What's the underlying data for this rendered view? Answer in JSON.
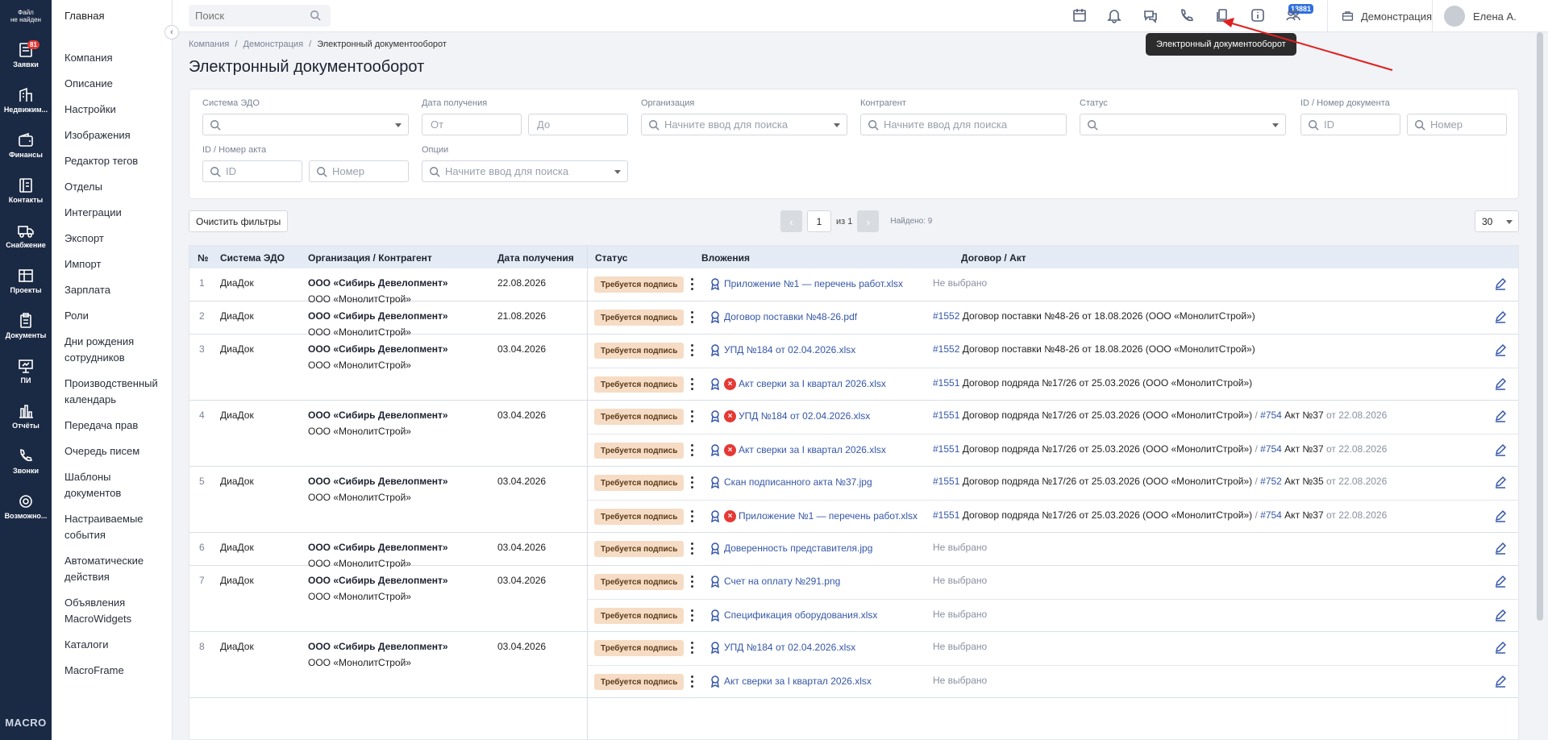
{
  "rail": {
    "logo_line1": "Файл",
    "logo_line2": "не найден",
    "items": [
      {
        "label": "Заявки",
        "icon": "requests-icon",
        "badge": "81"
      },
      {
        "label": "Недвижим...",
        "icon": "building-icon"
      },
      {
        "label": "Финансы",
        "icon": "wallet-icon"
      },
      {
        "label": "Контакты",
        "icon": "contacts-icon"
      },
      {
        "label": "Снабжение",
        "icon": "truck-icon"
      },
      {
        "label": "Проекты",
        "icon": "projects-icon"
      },
      {
        "label": "Документы",
        "icon": "documents-icon"
      },
      {
        "label": "ПИ",
        "icon": "presentation-icon"
      },
      {
        "label": "Отчёты",
        "icon": "reports-icon"
      },
      {
        "label": "Звонки",
        "icon": "phone-icon"
      },
      {
        "label": "Возможно...",
        "icon": "gear-icon"
      }
    ],
    "brand": "MACRO"
  },
  "sidebar": {
    "home": "Главная",
    "items": [
      "Компания",
      "Описание",
      "Настройки",
      "Изображения",
      "Редактор тегов",
      "Отделы",
      "Интеграции",
      "Экспорт",
      "Импорт",
      "Зарплата",
      "Роли",
      "Дни рождения сотрудников",
      "Производственный календарь",
      "Передача прав",
      "Очередь писем",
      "Шаблоны документов",
      "Настраиваемые события",
      "Автоматические действия",
      "Объявления MacroWidgets",
      "Каталоги",
      "MacroFrame"
    ]
  },
  "topbar": {
    "search_placeholder": "Поиск",
    "notif_count": "13881",
    "workspace": "Демонстрация",
    "user": "Елена А.",
    "tooltip": "Электронный документооборот"
  },
  "breadcrumb": {
    "items": [
      "Компания",
      "Демонстрация"
    ],
    "current": "Электронный документооборот",
    "sep": "/"
  },
  "page_title": "Электронный документооборот",
  "filters": {
    "edo_label": "Система ЭДО",
    "date_label": "Дата получения",
    "date_from": "От",
    "date_to": "До",
    "org_label": "Организация",
    "org_ph": "Начните ввод для поиска",
    "contr_label": "Контрагент",
    "contr_ph": "Начните ввод для поиска",
    "status_label": "Статус",
    "docid_label": "ID / Номер документа",
    "id_ph": "ID",
    "num_ph": "Номер",
    "actid_label": "ID / Номер акта",
    "act_id_ph": "ID",
    "act_num_ph": "Номер",
    "opts_label": "Опции",
    "opts_ph": "Начните ввод для поиска"
  },
  "controls": {
    "clear": "Очистить фильтры",
    "page": "1",
    "of": "из 1",
    "found": "Найдено: 9",
    "per_page": "30"
  },
  "table": {
    "headers": {
      "num": "№",
      "edo": "Система ЭДО",
      "org": "Организация / Контрагент",
      "date": "Дата получения",
      "status": "Статус",
      "att": "Вложения",
      "dog": "Договор / Акт"
    },
    "status_text": "Требуется подпись",
    "not_selected": "Не выбрано",
    "rows": [
      {
        "n": "1",
        "edo": "ДиаДок",
        "org": "ООО «Сибирь Девелопмент»",
        "contr": "ООО «МонолитСтрой»",
        "date": "22.08.2026",
        "items": [
          {
            "file": "Приложение №1 — перечень работ.xlsx",
            "err": false,
            "dog": null
          }
        ]
      },
      {
        "n": "2",
        "edo": "ДиаДок",
        "org": "ООО «Сибирь Девелопмент»",
        "contr": "ООО «МонолитСтрой»",
        "date": "21.08.2026",
        "items": [
          {
            "file": "Договор поставки №48-26.pdf",
            "err": false,
            "dog": {
              "id": "#1552",
              "text": "Договор поставки №48-26 от 18.08.2026 (ООО «МонолитСтрой»)"
            }
          }
        ]
      },
      {
        "n": "3",
        "edo": "ДиаДок",
        "org": "ООО «Сибирь Девелопмент»",
        "contr": "ООО «МонолитСтрой»",
        "date": "03.04.2026",
        "items": [
          {
            "file": "УПД №184 от 02.04.2026.xlsx",
            "err": false,
            "dog": {
              "id": "#1552",
              "text": "Договор поставки №48-26 от 18.08.2026 (ООО «МонолитСтрой»)"
            }
          },
          {
            "file": "Акт сверки за I квартал 2026.xlsx",
            "err": true,
            "dog": {
              "id": "#1551",
              "text": "Договор подряда №17/26 от 25.03.2026 (ООО «МонолитСтрой»)"
            }
          }
        ]
      },
      {
        "n": "4",
        "edo": "ДиаДок",
        "org": "ООО «Сибирь Девелопмент»",
        "contr": "ООО «МонолитСтрой»",
        "date": "03.04.2026",
        "items": [
          {
            "file": "УПД №184 от 02.04.2026.xlsx",
            "err": true,
            "dog": {
              "id": "#1551",
              "text": "Договор подряда №17/26 от 25.03.2026 (ООО «МонолитСтрой»)",
              "act_id": "#754",
              "act": "Акт №37",
              "act_date": "от 22.08.2026"
            }
          },
          {
            "file": "Акт сверки за I квартал 2026.xlsx",
            "err": true,
            "dog": {
              "id": "#1551",
              "text": "Договор подряда №17/26 от 25.03.2026 (ООО «МонолитСтрой»)",
              "act_id": "#754",
              "act": "Акт №37",
              "act_date": "от 22.08.2026"
            }
          }
        ]
      },
      {
        "n": "5",
        "edo": "ДиаДок",
        "org": "ООО «Сибирь Девелопмент»",
        "contr": "ООО «МонолитСтрой»",
        "date": "03.04.2026",
        "items": [
          {
            "file": "Скан подписанного акта №37.jpg",
            "err": false,
            "dog": {
              "id": "#1551",
              "text": "Договор подряда №17/26 от 25.03.2026 (ООО «МонолитСтрой»)",
              "act_id": "#752",
              "act": "Акт №35",
              "act_date": "от 22.08.2026"
            }
          },
          {
            "file": "Приложение №1 — перечень работ.xlsx",
            "err": true,
            "dog": {
              "id": "#1551",
              "text": "Договор подряда №17/26 от 25.03.2026 (ООО «МонолитСтрой»)",
              "act_id": "#754",
              "act": "Акт №37",
              "act_date": "от 22.08.2026"
            }
          }
        ]
      },
      {
        "n": "6",
        "edo": "ДиаДок",
        "org": "ООО «Сибирь Девелопмент»",
        "contr": "ООО «МонолитСтрой»",
        "date": "03.04.2026",
        "items": [
          {
            "file": "Доверенность представителя.jpg",
            "err": false,
            "dog": null
          }
        ]
      },
      {
        "n": "7",
        "edo": "ДиаДок",
        "org": "ООО «Сибирь Девелопмент»",
        "contr": "ООО «МонолитСтрой»",
        "date": "03.04.2026",
        "items": [
          {
            "file": "Счет на оплату №291.png",
            "err": false,
            "dog": null
          },
          {
            "file": "Спецификация оборудования.xlsx",
            "err": false,
            "dog": null
          }
        ]
      },
      {
        "n": "8",
        "edo": "ДиаДок",
        "org": "ООО «Сибирь Девелопмент»",
        "contr": "ООО «МонолитСтрой»",
        "date": "03.04.2026",
        "items": [
          {
            "file": "УПД №184 от 02.04.2026.xlsx",
            "err": false,
            "dog": null
          },
          {
            "file": "Акт сверки за I квартал 2026.xlsx",
            "err": false,
            "dog": null
          }
        ]
      }
    ]
  }
}
